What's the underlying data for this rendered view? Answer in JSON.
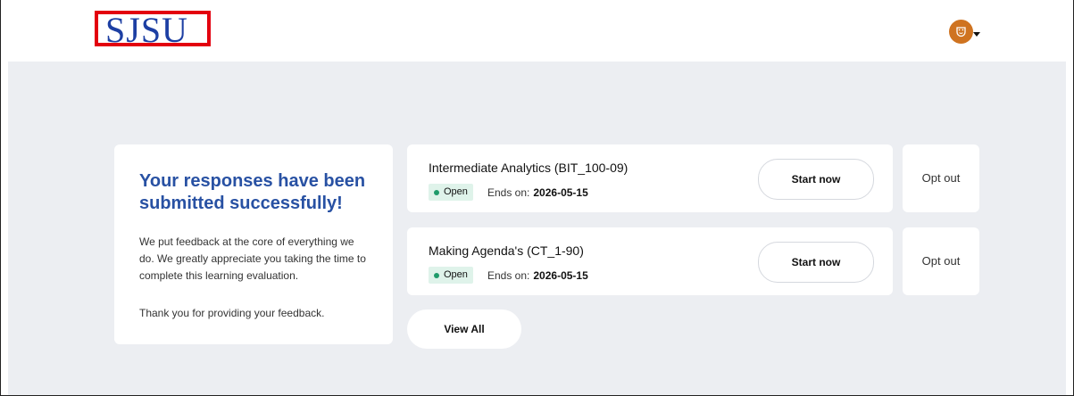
{
  "header": {
    "logo_text": "SJSU",
    "avatar_icon": "mask-icon"
  },
  "success_card": {
    "title": "Your responses have been submitted successfully!",
    "body": "We put feedback at the core of everything we do. We greatly appreciate you taking the time to complete this learning evaluation.",
    "thanks": "Thank you for providing your feedback."
  },
  "evaluations": [
    {
      "title": "Intermediate Analytics (BIT_100-09)",
      "status": "Open",
      "ends_label": "Ends on:",
      "ends_date": "2026-05-15",
      "start_label": "Start now",
      "opt_out_label": "Opt out"
    },
    {
      "title": "Making Agenda's (CT_1-90)",
      "status": "Open",
      "ends_label": "Ends on:",
      "ends_date": "2026-05-15",
      "start_label": "Start now",
      "opt_out_label": "Opt out"
    }
  ],
  "view_all_label": "View All",
  "colors": {
    "brand_blue": "#1d3fa3",
    "title_blue": "#2851a3",
    "highlight_red": "#e3000f",
    "avatar_orange": "#cf7320",
    "open_green": "#1f9b6a",
    "background": "#eceef2"
  }
}
